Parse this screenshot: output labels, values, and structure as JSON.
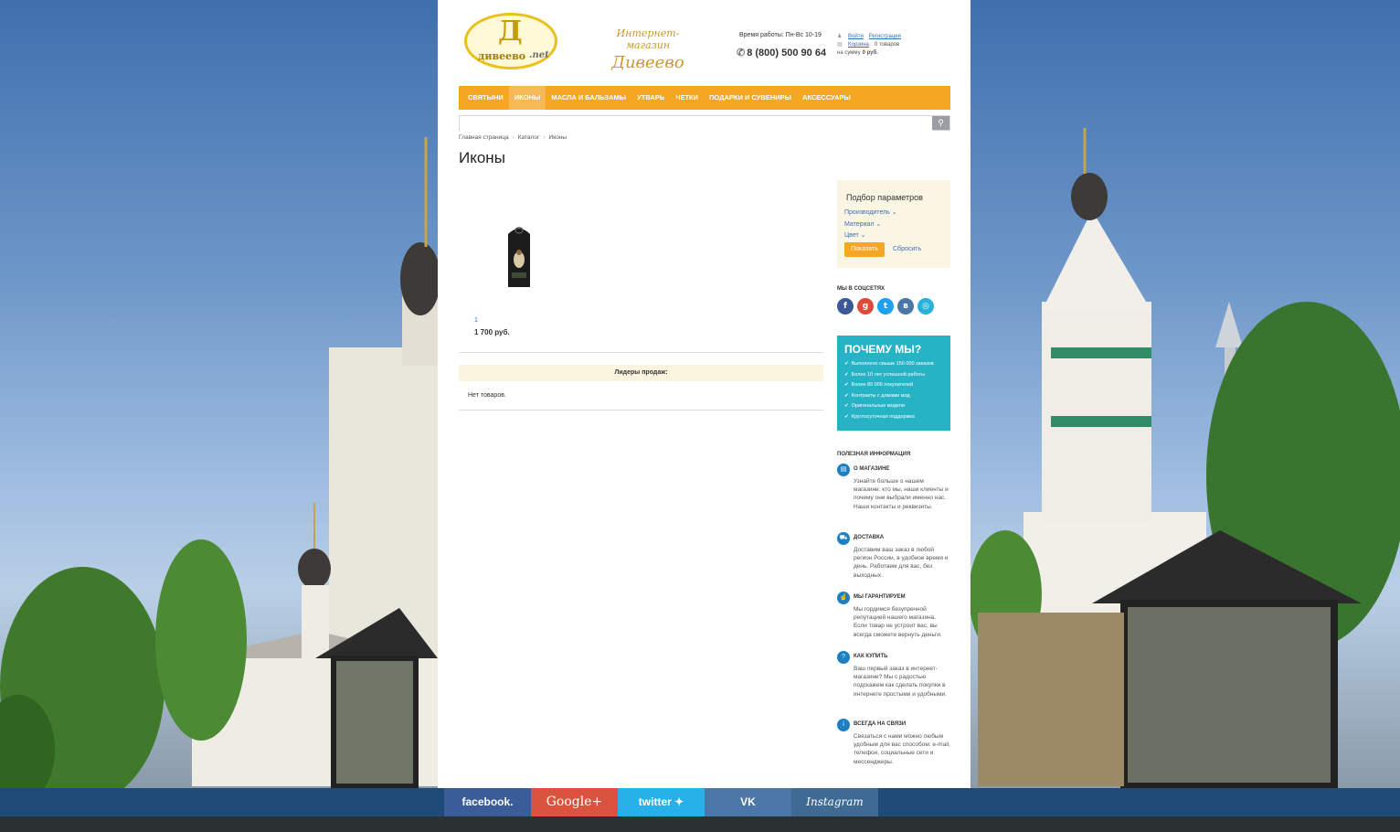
{
  "header": {
    "logo_main": "Д",
    "logo_site": "дивеево",
    "logo_tld": ".net",
    "shop_line1": "Интернет-магазин",
    "shop_line2": "Дивеево",
    "hours": "Время работы: Пн-Вс 10-19",
    "phone": "8 (800) 500 90 64",
    "login": "Войти",
    "register": "Регистрация",
    "cart": "Корзина",
    "cart_count": "0 товаров",
    "cart_sum_label": "на сумму",
    "cart_sum": "0 руб."
  },
  "nav": {
    "items": [
      "СВЯТЫНИ",
      "ИКОНЫ",
      "МАСЛА И БАЛЬЗАМЫ",
      "УТВАРЬ",
      "ЧЕТКИ",
      "ПОДАРКИ И СУВЕНИРЫ",
      "АКСЕССУАРЫ"
    ],
    "active": "ИКОНЫ"
  },
  "search": {
    "placeholder": ""
  },
  "breadcrumb": [
    "Главная страница",
    "Каталог",
    "Иконы"
  ],
  "page_title": "Иконы",
  "product": {
    "name": "1",
    "price": "1 700 руб."
  },
  "leaders": {
    "title": "Лидеры продаж:",
    "empty": "Нет товаров."
  },
  "filter": {
    "title": "Подбор параметров",
    "links": [
      "Производитель",
      "Материал",
      "Цвет"
    ],
    "show": "Показать",
    "reset": "Сбросить"
  },
  "social": {
    "label": "МЫ В СОЦСЕТЯХ"
  },
  "why": {
    "title": "ПОЧЕМУ МЫ?",
    "items": [
      "Выполнено свыше 150 000 заказов",
      "Более 10 лет успешной работы",
      "Более 80 000 покупателей",
      "Контракты с домами мод",
      "Оригинальные модели",
      "Круглосуточная поддержка"
    ]
  },
  "info": {
    "label": "ПОЛЕЗНАЯ ИНФОРМАЦИЯ",
    "blocks": [
      {
        "title": "О МАГАЗИНЕ",
        "text": "Узнайте больше о нашем магазине: кто мы, наши клиенты и почему они выбрали именно нас. Наши контакты и реквизиты."
      },
      {
        "title": "ДОСТАВКА",
        "text": "Доставим ваш заказ в любой регион России, в удобное время и день. Работаем для вас, без выходных."
      },
      {
        "title": "МЫ ГАРАНТИРУЕМ",
        "text": "Мы гордимся безупречной репутацией нашего магазина. Если товар не устроит вас, вы всегда сможете вернуть деньги."
      },
      {
        "title": "КАК КУПИТЬ",
        "text": "Ваш первый заказ в интернет-магазине? Мы с радостью подскажем как сделать покупки в интернете простыми и удобными."
      },
      {
        "title": "ВСЕГДА НА СВЯЗИ",
        "text": "Связаться с нами можно любым удобным для вас способом: e-mail, телефон, социальные сети и мессенджеры."
      }
    ]
  },
  "share": {
    "facebook": "facebook.",
    "google": "Google+",
    "twitter": "twitter",
    "vk": "VK",
    "instagram": "Instagram"
  },
  "colors": {
    "accent": "#f5a623",
    "link": "#3a6fb0",
    "why_bg": "#27b3c6",
    "bottom_bar": "#1e4b78"
  }
}
